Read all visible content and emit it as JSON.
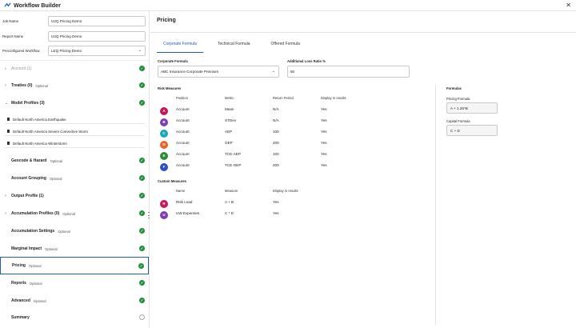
{
  "app": {
    "title": "Workflow Builder"
  },
  "left": {
    "fields": [
      {
        "label": "Job Name",
        "value": "U2Q Pricing Demo"
      },
      {
        "label": "Report Name",
        "value": "U2Q Pricing Demo"
      },
      {
        "label": "Preconfigured Workflow",
        "value": "LEQ Pricing Demo"
      }
    ],
    "nav": {
      "account": "Account (1)",
      "treaties": "Treaties (0)",
      "model_profiles": "Model Profiles (3)",
      "model_items": [
        "Default North America Earthquake",
        "Default North America Severe Convective Storm",
        "Default North America Winterstorm"
      ],
      "geocode": "Geocode & Hazard",
      "account_grouping": "Account Grouping",
      "output_profile": "Output Profile (1)",
      "accumulation_profiles": "Accumulation Profiles (0)",
      "accumulation_settings": "Accumulation Settings",
      "marginal_impact": "Marginal Impact",
      "pricing": "Pricing",
      "reports": "Reports",
      "advanced": "Advanced",
      "summary": "Summary",
      "optional": "Optional"
    }
  },
  "main": {
    "title": "Pricing",
    "tabs": [
      "Corporate Formula",
      "Technical Formula",
      "Offered Formula"
    ],
    "corporate_formula_label": "Corporate Formula",
    "corporate_formula_value": "ABC Insurance Corporate Premium",
    "loss_ratio_label": "Additional Loss Ratio %",
    "loss_ratio_value": "50",
    "risk_measures_label": "Risk Measures",
    "risk_headers": [
      "Position",
      "Metric",
      "Return Period",
      "Display in results"
    ],
    "risk_rows": [
      {
        "badge": "A",
        "color": "#c2185b",
        "position": "Account",
        "metric": "Mean",
        "rp": "N/A",
        "display": "Yes"
      },
      {
        "badge": "B",
        "color": "#7b3fb0",
        "position": "Account",
        "metric": "STDev",
        "rp": "N/A",
        "display": "Yes"
      },
      {
        "badge": "C",
        "color": "#19a7b8",
        "position": "Account",
        "metric": "AEP",
        "rp": "100",
        "display": "Yes"
      },
      {
        "badge": "D",
        "color": "#e8652a",
        "position": "Account",
        "metric": "OEP",
        "rp": "200",
        "display": "Yes"
      },
      {
        "badge": "E",
        "color": "#2e8b3a",
        "position": "Account",
        "metric": "TCE-AEP",
        "rp": "100",
        "display": "Yes"
      },
      {
        "badge": "F",
        "color": "#2a4fc2",
        "position": "Account",
        "metric": "TCE-OEP",
        "rp": "200",
        "display": "Yes"
      }
    ],
    "custom_measures_label": "Custom Measures",
    "custom_headers": [
      "Name",
      "Measure",
      "Display in results"
    ],
    "custom_rows": [
      {
        "badge": "R",
        "color": "#c2185b",
        "name": "Risk Load",
        "measure": "A + B",
        "display": "Yes"
      },
      {
        "badge": "U",
        "color": "#7b3fb0",
        "name": "UW Expenses",
        "measure": "C * D",
        "display": "Yes"
      }
    ],
    "formulas_label": "Formulas",
    "pricing_formula_label": "Pricing Formula",
    "pricing_formula_value": "A + 1.25*B",
    "capital_formula_label": "Capital Formula",
    "capital_formula_value": "C + D"
  }
}
